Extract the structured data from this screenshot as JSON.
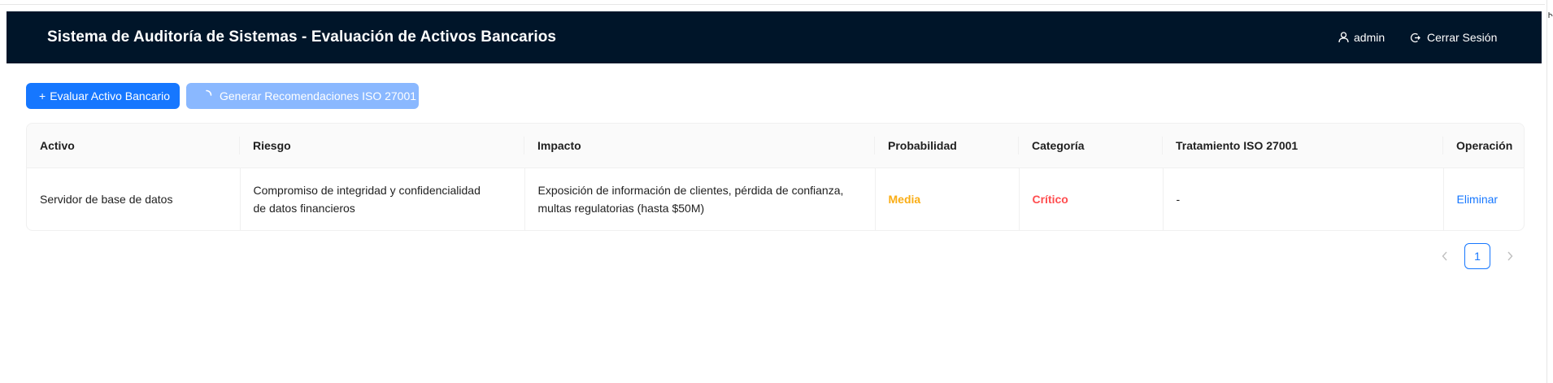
{
  "header": {
    "title": "Sistema de Auditoría de Sistemas - Evaluación de Activos Bancarios",
    "user_label": "admin",
    "logout_label": "Cerrar Sesión"
  },
  "toolbar": {
    "evaluate_prefix": "+",
    "evaluate_label": "Evaluar Activo Bancario",
    "recommend_label": "Generar Recomendaciones ISO 27001"
  },
  "table": {
    "columns": [
      "Activo",
      "Riesgo",
      "Impacto",
      "Probabilidad",
      "Categoría",
      "Tratamiento ISO 27001",
      "Operación"
    ],
    "rows": [
      {
        "activo": "Servidor de base de datos",
        "riesgo": "Compromiso de integridad y confidencialidad de datos financieros",
        "impacto": "Exposición de información de clientes, pérdida de confianza, multas regulatorias (hasta $50M)",
        "probabilidad": "Media",
        "categoria": "Crítico",
        "tratamiento": "-",
        "operacion": "Eliminar"
      }
    ]
  },
  "pagination": {
    "current": "1"
  },
  "colors": {
    "header_bg": "#001529",
    "primary": "#1677ff",
    "loading_button": "#8ab8ff",
    "probability_medium": "#faad14",
    "category_critical": "#ff4d4f"
  },
  "icons": {
    "user": "user-icon",
    "logout": "logout-icon",
    "spinner": "loading-spinner-icon",
    "prev": "chevron-left-icon",
    "next": "chevron-right-icon"
  }
}
